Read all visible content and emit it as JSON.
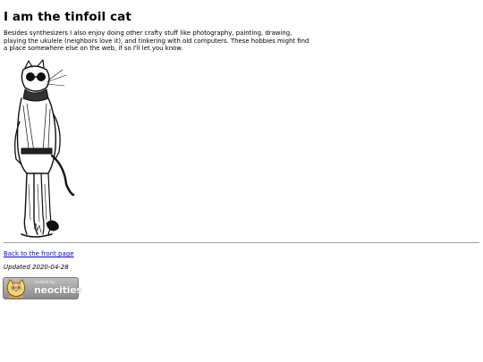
{
  "page": {
    "title": "I am the tinfoil cat",
    "intro": "Besides synthesizers I also enjoy doing other crafty stuff like photography, painting, drawing, playing the ukulele (neighbors love it), and tinkering with old computers. These hobbies might find a place somewhere else on the web, if so I'll let you know."
  },
  "illustration": {
    "icon": "tinfoil-cat-drawing"
  },
  "footer": {
    "back_link": "Back to the front page",
    "updated": "Updated 2020-04-28"
  },
  "badge": {
    "hosted_by": "hosted by",
    "brand": "neocities",
    "icon": "neocities-cat-logo"
  }
}
